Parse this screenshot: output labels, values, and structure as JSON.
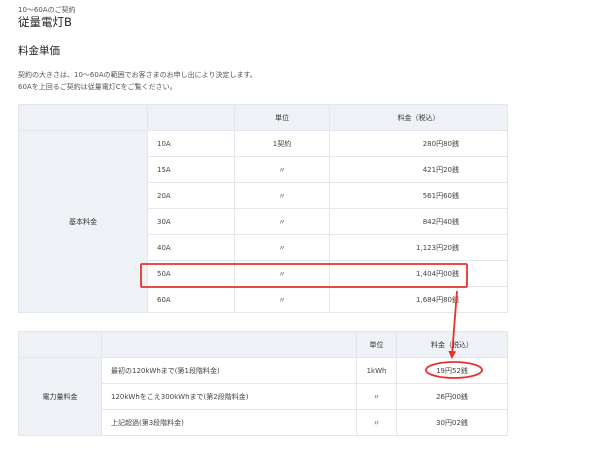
{
  "header": {
    "subtitle": "10～60Aのご契約",
    "plan_title": "従量電灯B",
    "section_title": "料金単価",
    "note_line1": "契約の大きさは、10～60Aの範囲でお客さまのお申し出により決定します。",
    "note_line2": "60Aを上回るご契約は従量電灯Cをご覧ください。"
  },
  "basic_table": {
    "columns": [
      "",
      "",
      "単位",
      "料金（税込）"
    ],
    "row_label": "基本料金",
    "rows": [
      {
        "ampere": "10A",
        "unit": "1契約",
        "price": "280円80銭"
      },
      {
        "ampere": "15A",
        "unit": "〃",
        "price": "421円20銭"
      },
      {
        "ampere": "20A",
        "unit": "〃",
        "price": "561円60銭"
      },
      {
        "ampere": "30A",
        "unit": "〃",
        "price": "842円40銭"
      },
      {
        "ampere": "40A",
        "unit": "〃",
        "price": "1,123円20銭"
      },
      {
        "ampere": "50A",
        "unit": "〃",
        "price": "1,404円00銭"
      },
      {
        "ampere": "60A",
        "unit": "〃",
        "price": "1,684円80銭"
      }
    ]
  },
  "usage_table": {
    "columns": [
      "",
      "",
      "単位",
      "料金（税込）"
    ],
    "row_label": "電力量料金",
    "rows": [
      {
        "tier": "最初の120kWhまで(第1段階料金)",
        "unit": "1kWh",
        "price": "19円52銭"
      },
      {
        "tier": "120kWhをこえ300kWhまで(第2段階料金)",
        "unit": "〃",
        "price": "26円00銭"
      },
      {
        "tier": "上記超過(第3段階料金)",
        "unit": "〃",
        "price": "30円02銭"
      }
    ]
  },
  "annotations": {
    "highlight_color": "#e8312f"
  }
}
